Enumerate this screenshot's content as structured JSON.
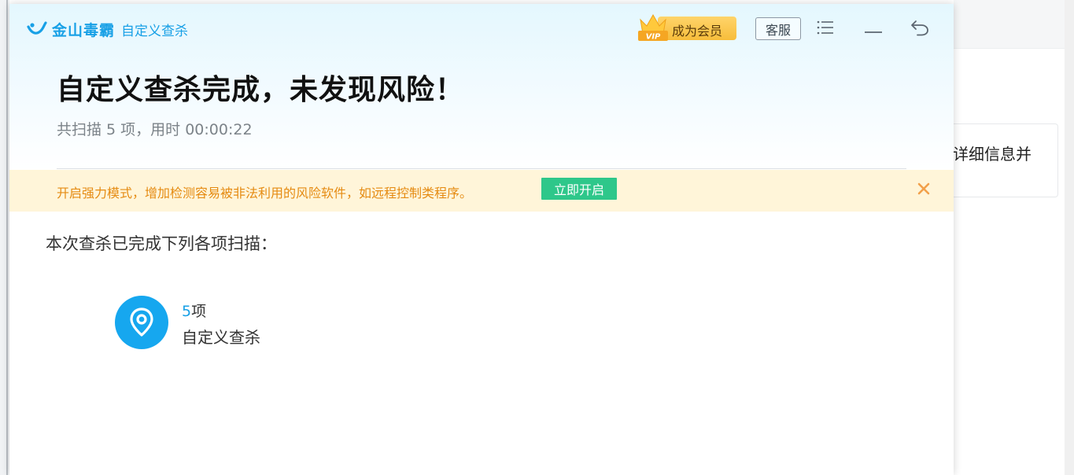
{
  "app": {
    "brand": "金山毒霸",
    "subtitle": "自定义查杀"
  },
  "header": {
    "vip_label": "成为会员",
    "vip_badge_text": "VIP",
    "service_label": "客服"
  },
  "result": {
    "headline": "自定义查杀完成，未发现风险！",
    "summary": "共扫描 5 项，用时 00:00:22"
  },
  "notice": {
    "text": "开启强力模式，增加检测容易被非法利用的风险软件，如远程控制类程序。",
    "button_label": "立即开启"
  },
  "section": {
    "title": "本次查杀已完成下列各项扫描："
  },
  "scan_items": [
    {
      "count": "5",
      "unit": "项",
      "name": "自定义查杀",
      "icon": "location-pin-icon"
    }
  ],
  "background": {
    "card_text": "详细信息并"
  },
  "colors": {
    "brand_blue": "#18a0e6",
    "notice_bg": "#fff5d9",
    "notice_text": "#e58b12",
    "notice_button": "#2ec78a",
    "vip_gold": "#f7bd3b"
  }
}
